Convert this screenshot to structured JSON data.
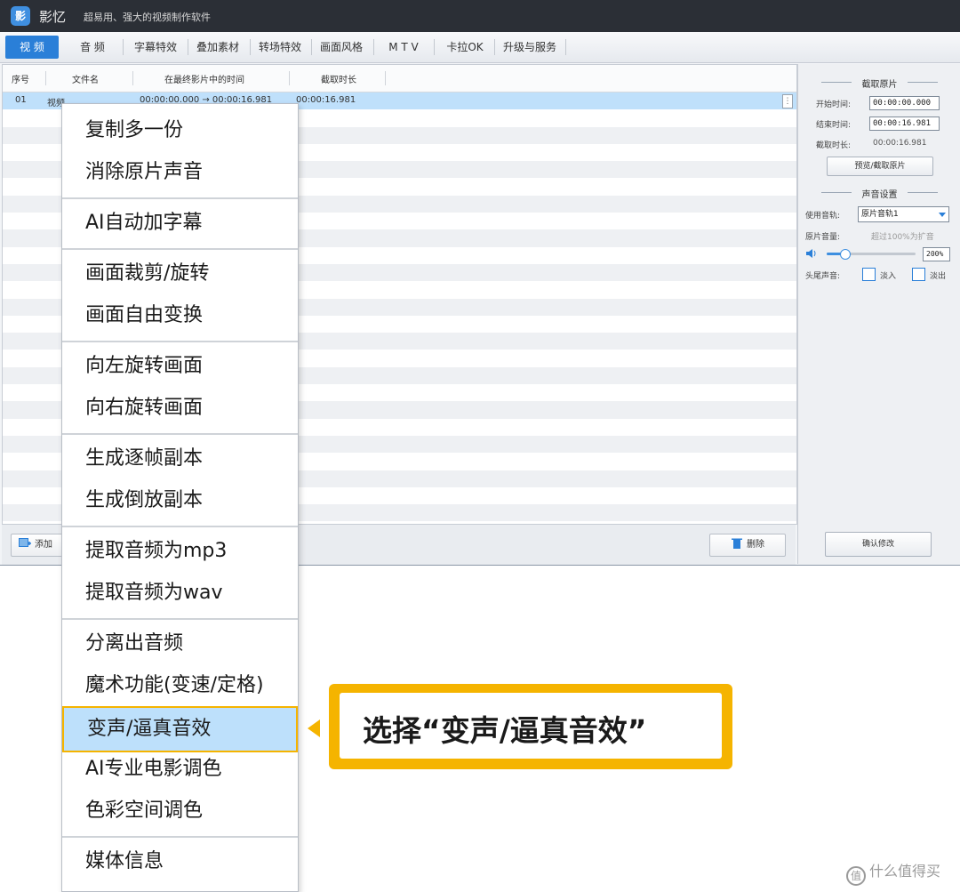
{
  "app": {
    "icon_text": "影",
    "name": "影忆",
    "slogan": "超易用、强大的视频制作软件"
  },
  "menubar": {
    "tabs": [
      {
        "label": "视 频",
        "active": true
      },
      {
        "label": "音 频"
      },
      {
        "label": "字幕特效"
      },
      {
        "label": "叠加素材"
      },
      {
        "label": "转场特效"
      },
      {
        "label": "画面风格"
      },
      {
        "label": "M T V"
      },
      {
        "label": "卡拉OK"
      },
      {
        "label": "升级与服务"
      }
    ]
  },
  "table": {
    "headers": [
      "序号",
      "文件名",
      "在最终影片中的时间",
      "截取时长"
    ],
    "rows": [
      {
        "index": "01",
        "name": "视频",
        "time": "00:00:00.000 → 00:00:16.981",
        "duration": "00:00:16.981"
      }
    ],
    "handle": "⋮"
  },
  "bottombar": {
    "add_label": "添加",
    "delete_label": "删除"
  },
  "panel": {
    "clip_title": "截取原片",
    "start_label": "开始时间:",
    "start_value": "00:00:00.000",
    "end_label": "结束时间:",
    "end_value": "00:00:16.981",
    "duration_label": "截取时长:",
    "duration_value": "00:00:16.981",
    "preview_button": "预览/截取原片",
    "audio_title": "声音设置",
    "track_label": "使用音轨:",
    "track_value": "原片音轨1",
    "volume_label": "原片音量:",
    "volume_hint": "超过100%为扩音",
    "volume_value": "200%",
    "volume_level": 0.2,
    "fade_label": "头尾声音:",
    "fade_in": "淡入",
    "fade_out": "淡出",
    "confirm_button": "确认修改"
  },
  "context_menu": {
    "items": [
      {
        "label": "复制多一份"
      },
      {
        "label": "消除原片声音"
      },
      {
        "label": "AI自动加字幕"
      },
      {
        "label": "画面裁剪/旋转"
      },
      {
        "label": "画面自由变换"
      },
      {
        "label": "向左旋转画面"
      },
      {
        "label": "向右旋转画面"
      },
      {
        "label": "生成逐帧副本"
      },
      {
        "label": "生成倒放副本"
      },
      {
        "label": "提取音频为mp3"
      },
      {
        "label": "提取音频为wav"
      },
      {
        "label": "分离出音频"
      },
      {
        "label": "魔术功能(变速/定格)"
      },
      {
        "label": "变声/逼真音效",
        "highlighted": true
      },
      {
        "label": "AI专业电影调色"
      },
      {
        "label": "色彩空间调色"
      },
      {
        "label": "媒体信息"
      }
    ]
  },
  "callout": {
    "text": "选择“变声/逼真音效”",
    "color": "#f5b400"
  },
  "watermark": {
    "icon": "值",
    "text": "什么值得买"
  }
}
